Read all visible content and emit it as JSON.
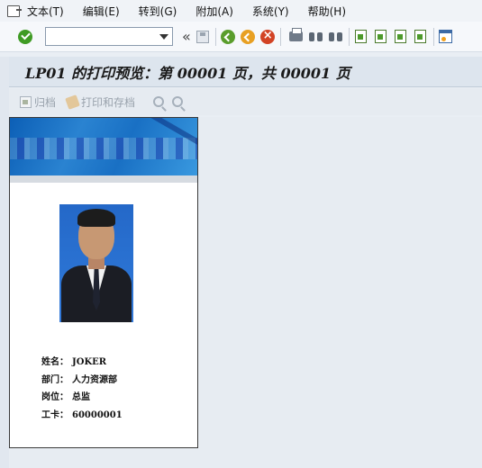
{
  "menubar": {
    "items": [
      "文本(T)",
      "编辑(E)",
      "转到(G)",
      "附加(A)",
      "系统(Y)",
      "帮助(H)"
    ]
  },
  "toolbar": {
    "command_field_value": "",
    "icons": [
      "enter-check-icon",
      "save-icon",
      "back-icon",
      "exit-icon",
      "cancel-icon",
      "print-icon",
      "find-icon",
      "find-next-icon",
      "first-page-icon",
      "previous-page-icon",
      "next-page-icon",
      "last-page-icon",
      "layout-menu-icon"
    ]
  },
  "title": {
    "text": "LP01 的打印预览：第 00001 页，共 00001  页"
  },
  "app_toolbar": {
    "archive_label": "归档",
    "print_archive_label": "打印和存档"
  },
  "document": {
    "fields": [
      {
        "label": "姓名：",
        "value": "JOKER"
      },
      {
        "label": "部门：",
        "value": "人力资源部"
      },
      {
        "label": "岗位：",
        "value": "总监"
      },
      {
        "label": "工卡：",
        "value": "60000001"
      }
    ]
  }
}
